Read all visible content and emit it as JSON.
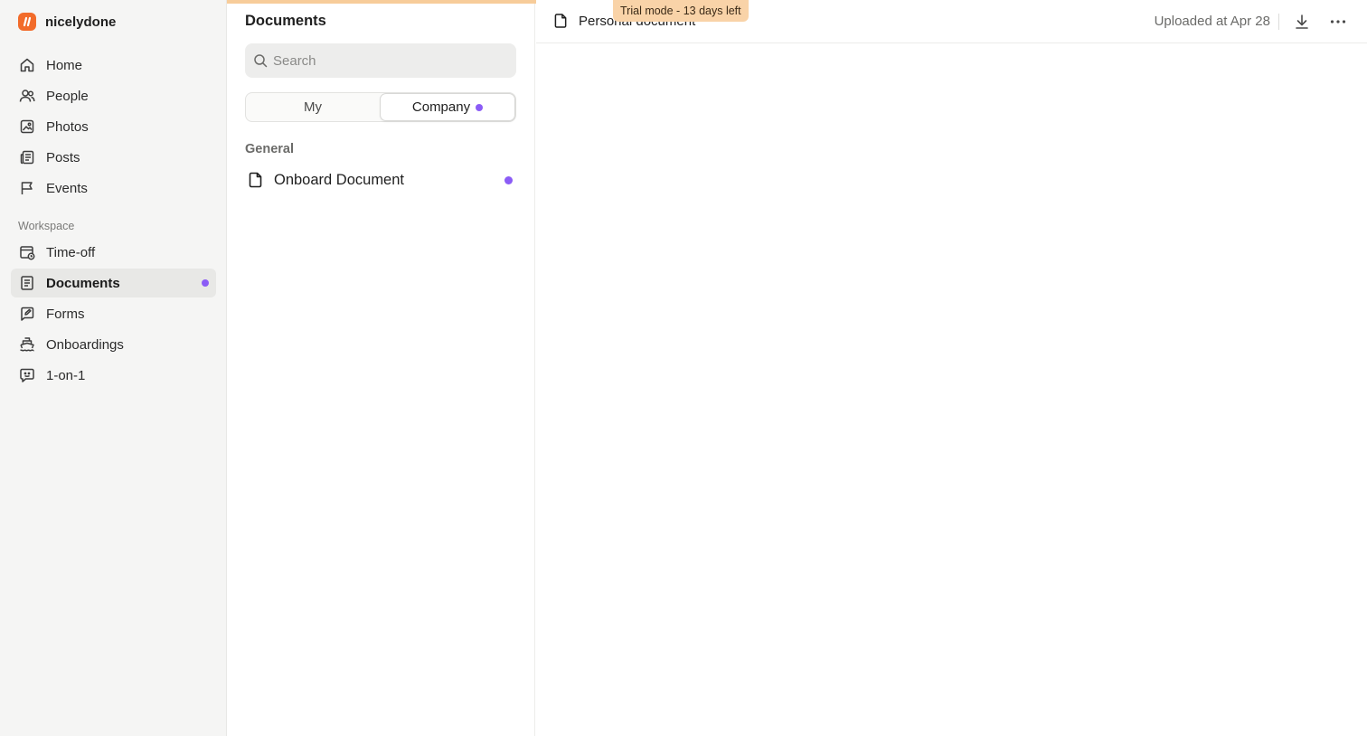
{
  "brand": {
    "name": "nicelydone",
    "accent": "#f26b2a"
  },
  "sidebar": {
    "items": [
      {
        "label": "Home",
        "icon": "home-icon"
      },
      {
        "label": "People",
        "icon": "people-icon"
      },
      {
        "label": "Photos",
        "icon": "image-icon"
      },
      {
        "label": "Posts",
        "icon": "newspaper-icon"
      },
      {
        "label": "Events",
        "icon": "flag-icon"
      }
    ],
    "workspace_label": "Workspace",
    "workspace_items": [
      {
        "label": "Time-off",
        "icon": "calendar-clock-icon"
      },
      {
        "label": "Documents",
        "icon": "document-list-icon",
        "active": true,
        "has_dot": true
      },
      {
        "label": "Forms",
        "icon": "form-edit-icon"
      },
      {
        "label": "Onboardings",
        "icon": "ship-icon"
      },
      {
        "label": "1-on-1",
        "icon": "chat-face-icon"
      }
    ]
  },
  "documents_panel": {
    "title": "Documents",
    "search": {
      "placeholder": "Search",
      "value": ""
    },
    "tabs": [
      {
        "label": "My",
        "selected": false
      },
      {
        "label": "Company",
        "selected": true,
        "has_dot": true
      }
    ],
    "groups": [
      {
        "label": "General",
        "documents": [
          {
            "name": "Onboard Document",
            "unread": true
          }
        ]
      }
    ]
  },
  "viewer": {
    "document_title": "Personal document",
    "uploaded_text": "Uploaded at Apr 28",
    "actions": [
      "download-icon",
      "more-icon"
    ]
  },
  "trial_banner": {
    "text": "Trial mode - 13 days left",
    "color": "#f9d3a8"
  },
  "colors": {
    "notification_dot": "#8b5cf6",
    "sidebar_bg": "#f5f5f4"
  }
}
